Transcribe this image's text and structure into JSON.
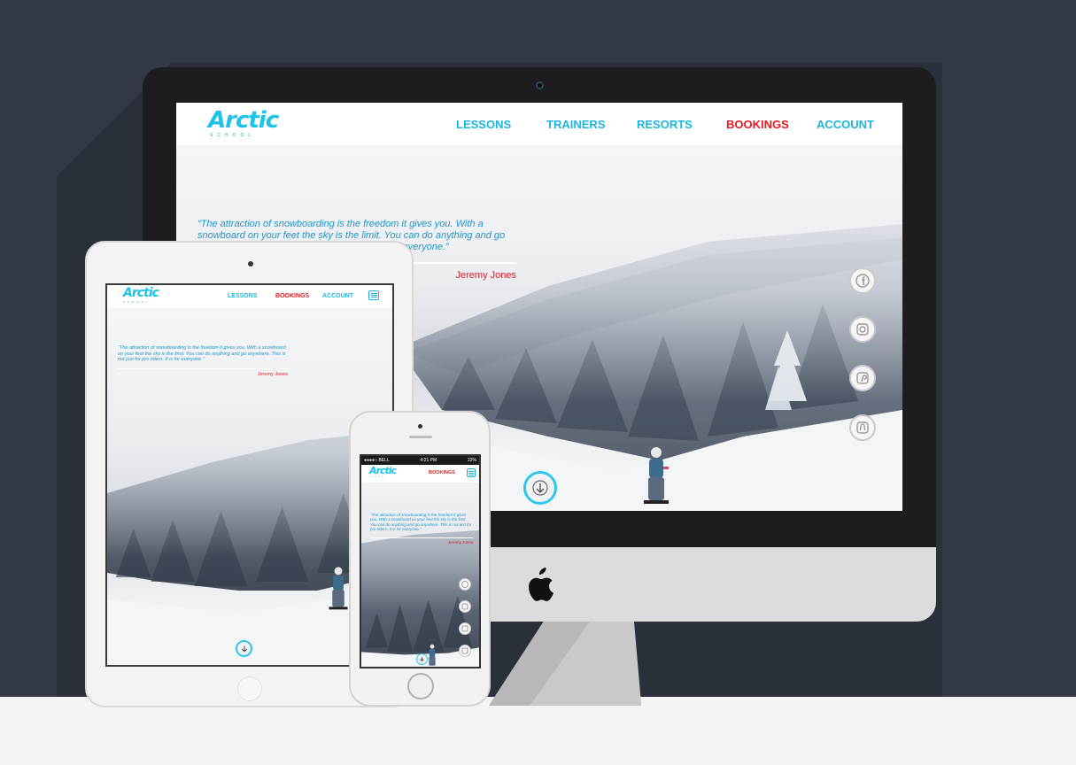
{
  "brand": {
    "logo": "Arctic",
    "tagline": "SCHOOL"
  },
  "desktop": {
    "nav": [
      {
        "label": "LESSONS",
        "active": false
      },
      {
        "label": "TRAINERS",
        "active": false
      },
      {
        "label": "RESORTS",
        "active": false
      },
      {
        "label": "BOOKINGS",
        "active": true
      },
      {
        "label": "ACCOUNT",
        "active": false
      }
    ],
    "social": [
      "facebook-icon",
      "instagram-icon",
      "pinterest-icon",
      "snapchat-icon"
    ]
  },
  "tablet": {
    "nav": [
      {
        "label": "LESSONS",
        "active": false
      },
      {
        "label": "BOOKINGS",
        "active": true
      },
      {
        "label": "ACCOUNT",
        "active": false
      }
    ]
  },
  "phone": {
    "status": {
      "carrier": "●●●●○ BELL",
      "time": "4:21 PM",
      "battery": "22%"
    },
    "nav": [
      {
        "label": "BOOKINGS",
        "active": true
      }
    ]
  },
  "hero": {
    "quote": "“The attraction of snowboarding is the freedom it gives you. With a snowboard on your feet the sky is the limit. You can do anything and go anywhere. This is not just for pro riders. It is for everyone.”",
    "author": "Jeremy Jones"
  },
  "colors": {
    "accent": "#1bb6e0",
    "active": "#e31b23",
    "background": "#323945"
  }
}
